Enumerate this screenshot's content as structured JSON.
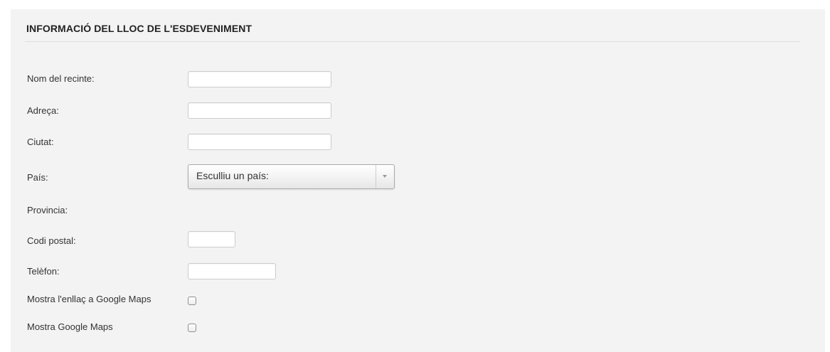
{
  "section": {
    "title": "INFORMACIÓ DEL LLOC DE L'ESDEVENIMENT"
  },
  "form": {
    "venue_name": {
      "label": "Nom del recinte:",
      "value": ""
    },
    "address": {
      "label": "Adreça:",
      "value": ""
    },
    "city": {
      "label": "Ciutat:",
      "value": ""
    },
    "country": {
      "label": "País:",
      "selected": "Esculliu un país:"
    },
    "province": {
      "label": "Provincia:"
    },
    "postal_code": {
      "label": "Codi postal:",
      "value": ""
    },
    "phone": {
      "label": "Telèfon:",
      "value": ""
    },
    "show_maps_link": {
      "label": "Mostra l'enllaç a Google Maps",
      "checked": false
    },
    "show_maps": {
      "label": "Mostra Google Maps",
      "checked": false
    }
  },
  "colors": {
    "panel_background": "#f3f3f3",
    "divider": "#dddddd",
    "text": "#333333"
  }
}
